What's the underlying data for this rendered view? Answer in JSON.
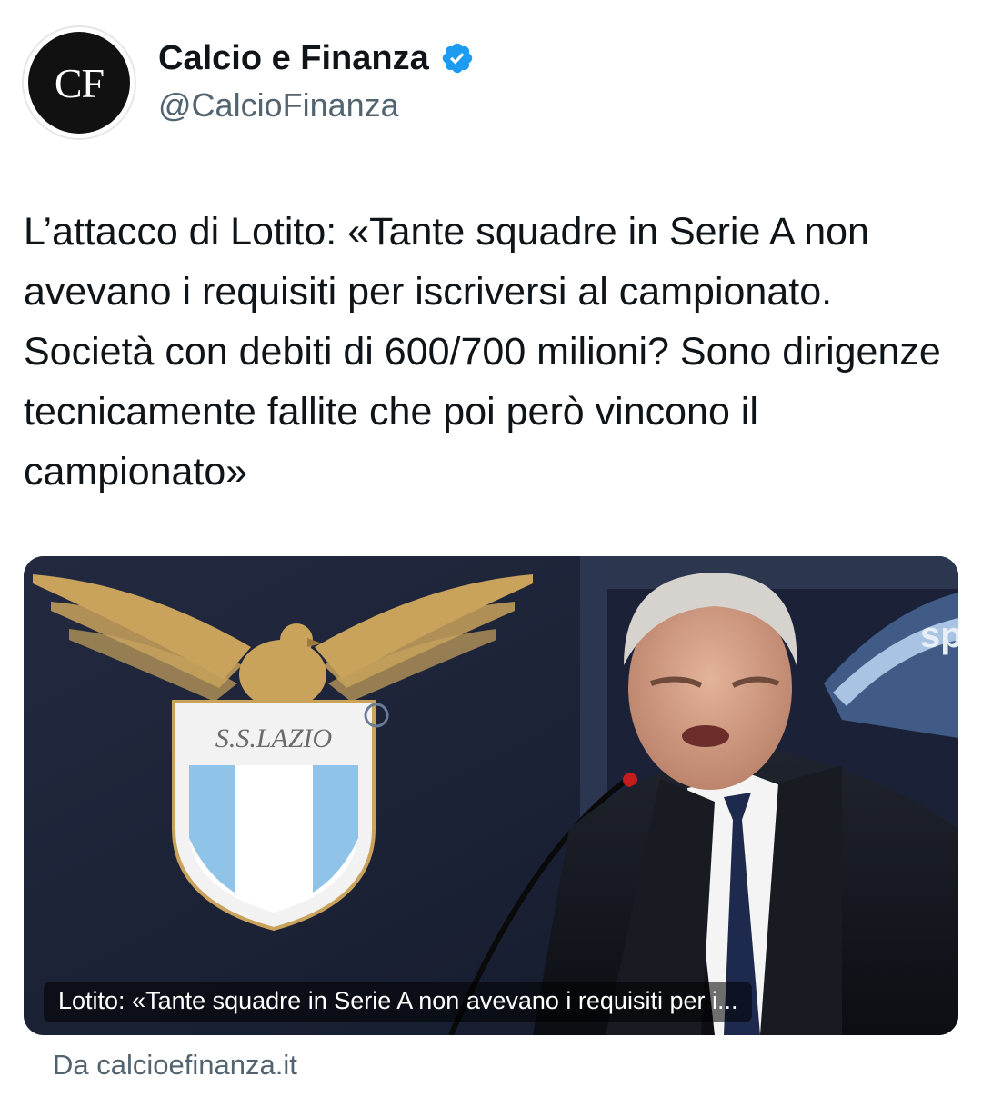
{
  "author": {
    "display_name": "Calcio e Finanza",
    "handle": "@CalcioFinanza",
    "avatar_text": "CF",
    "verified": true
  },
  "tweet": {
    "text": "L’attacco di Lotito: «Tante squadre in Serie A non avevano i requisiti per iscriversi al campionato. Società con debiti di 600/700 milioni? Sono dirigenze tecnicamente fallite che poi però vincono il campionato»"
  },
  "card": {
    "image_description_icon": "photo",
    "shield_text": "S.S.LAZIO",
    "backdrop_text": "sp",
    "caption": "Lotito: «Tante squadre in Serie A non avevano i requisiti per i..."
  },
  "source": {
    "label": "Da calcioefinanza.it"
  },
  "colors": {
    "verified": "#1d9bf0",
    "muted_text": "#536471",
    "primary_text": "#0f1419"
  }
}
